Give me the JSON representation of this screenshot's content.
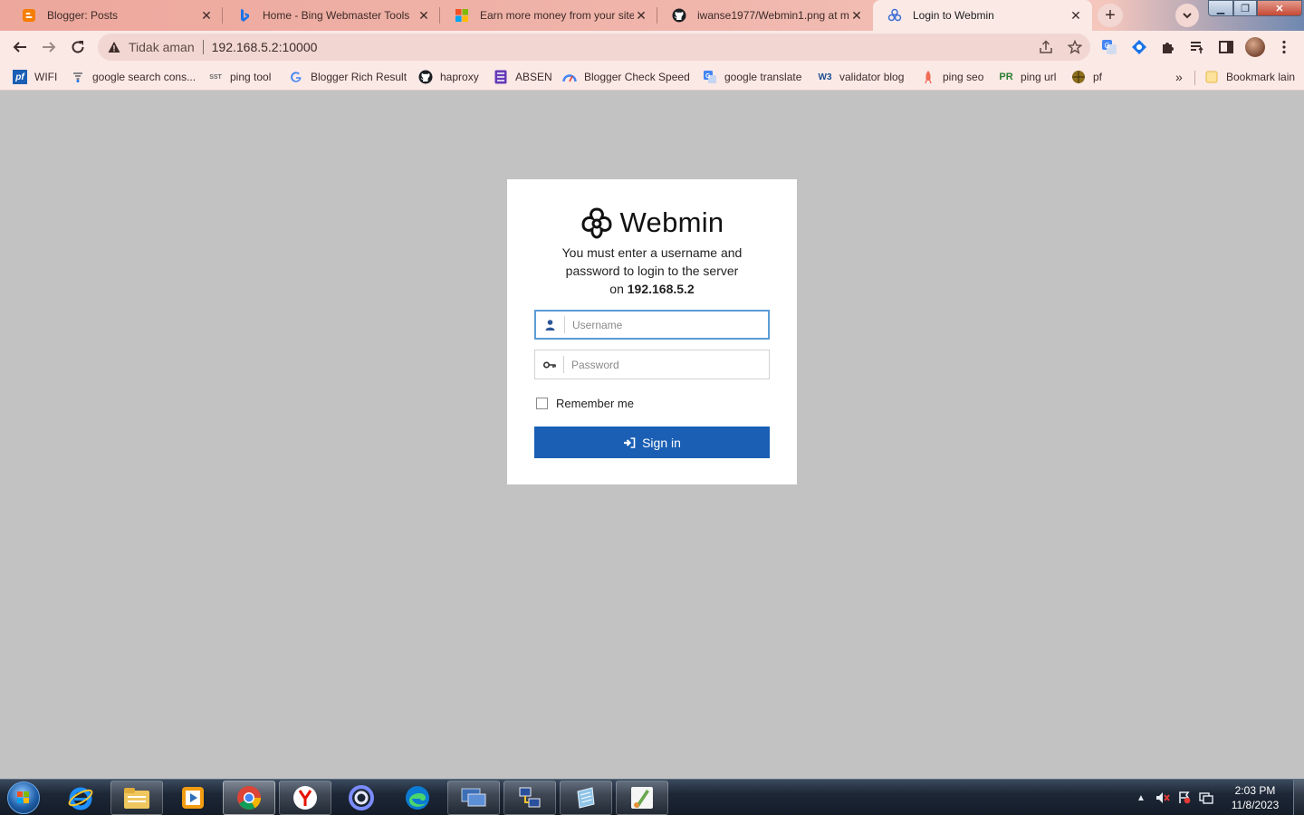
{
  "browser": {
    "tabs": [
      {
        "title": "Blogger: Posts",
        "icon": "blogger-icon"
      },
      {
        "title": "Home - Bing Webmaster Tools",
        "icon": "bing-icon"
      },
      {
        "title": "Earn more money from your site",
        "icon": "microsoft-icon"
      },
      {
        "title": "iwanse1977/Webmin1.png at ma",
        "icon": "github-icon"
      },
      {
        "title": "Login to Webmin",
        "icon": "webmin-icon"
      }
    ],
    "active_tab": 4,
    "security_label": "Tidak aman",
    "url": "192.168.5.2:10000",
    "bookmarks": [
      {
        "label": "WIFI",
        "icon": "pf-icon"
      },
      {
        "label": "google search cons...",
        "icon": "search-console-icon"
      },
      {
        "label": "ping tool",
        "icon": "sst-icon"
      },
      {
        "label": "Blogger Rich Result",
        "icon": "google-icon"
      },
      {
        "label": "haproxy",
        "icon": "github-icon"
      },
      {
        "label": "ABSEN",
        "icon": "forms-icon"
      },
      {
        "label": "Blogger Check Speed",
        "icon": "speed-icon"
      },
      {
        "label": "google translate",
        "icon": "translate-icon"
      },
      {
        "label": "validator blog",
        "icon": "w3c-icon"
      },
      {
        "label": "ping seo",
        "icon": "rocket-icon"
      },
      {
        "label": "ping url",
        "icon": "pr-icon"
      },
      {
        "label": "pf",
        "icon": "globe-icon"
      }
    ],
    "other_bookmarks": "Bookmark lain"
  },
  "login": {
    "brand": "Webmin",
    "message_line1": "You must enter a username and",
    "message_line2": "password to login to the server",
    "message_prefix": "on",
    "server": "192.168.5.2",
    "username_placeholder": "Username",
    "password_placeholder": "Password",
    "remember_label": "Remember me",
    "signin_label": "Sign in"
  },
  "taskbar": {
    "apps": [
      "internet-explorer-icon",
      "file-explorer-icon",
      "media-player-icon",
      "chrome-icon",
      "yandex-icon",
      "screencast-icon",
      "edge-icon",
      "remote-desktop-icon",
      "network-icon",
      "notepad-icon",
      "paint-icon"
    ],
    "time": "2:03 PM",
    "date": "11/8/2023"
  },
  "colors": {
    "accent": "#1a5fb4",
    "focus_border": "#5b9bd5",
    "page_bg": "#c2c2c2",
    "tab_bg": "#eda79c"
  }
}
